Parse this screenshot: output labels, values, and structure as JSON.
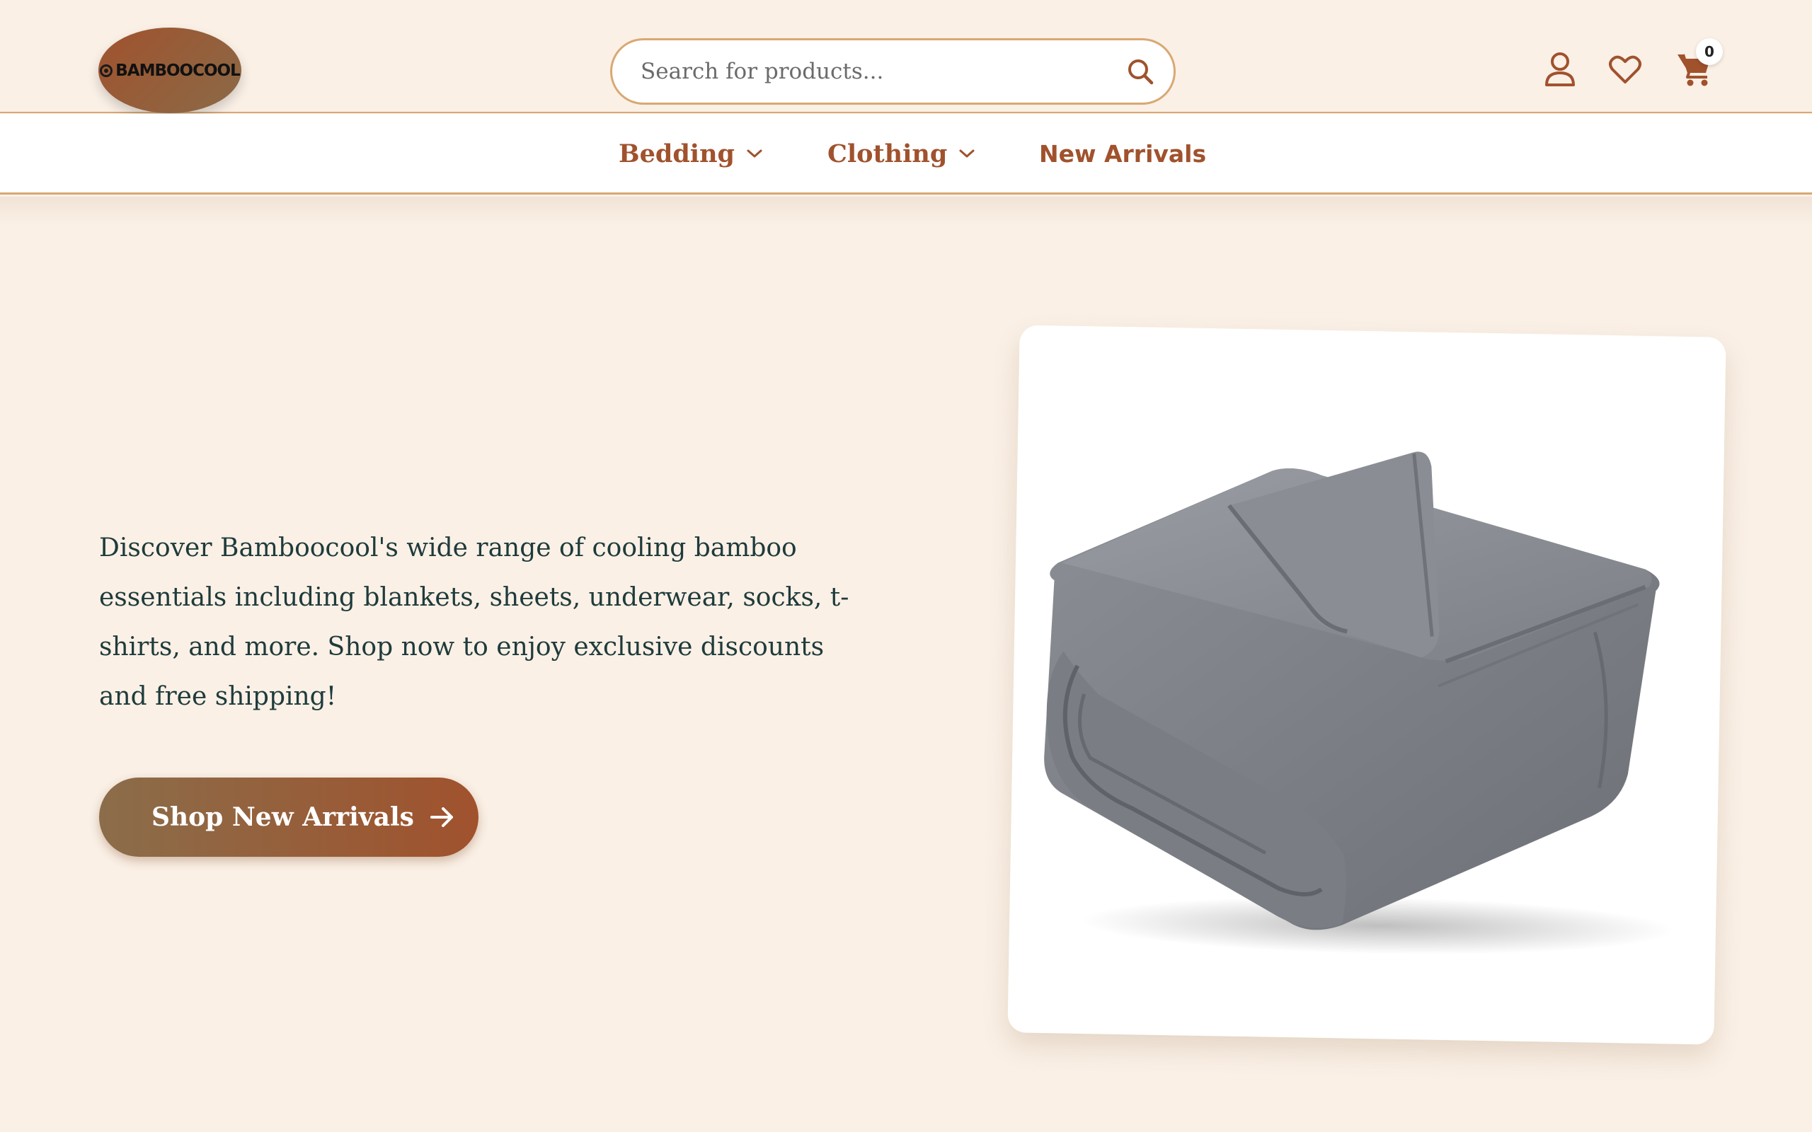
{
  "header": {
    "logo_text": "BAMBOOCOOL",
    "search": {
      "placeholder": "Search for products..."
    },
    "cart_count": "0"
  },
  "nav": {
    "items": [
      {
        "label": "Bedding",
        "has_dropdown": true
      },
      {
        "label": "Clothing",
        "has_dropdown": true
      },
      {
        "label": "New Arrivals",
        "has_dropdown": false
      }
    ]
  },
  "hero": {
    "description": "Discover Bamboocool's wide range of cooling bamboo essentials including blankets, sheets, underwear, socks, t-shirts, and more. Shop now to enjoy exclusive discounts and free shipping!",
    "cta_label": "Shop New Arrivals",
    "image": "folded-gray-blanket"
  },
  "colors": {
    "background": "#faf0e6",
    "accent": "#a0522d",
    "border": "#d9a873",
    "text": "#1f3b3b"
  },
  "icons": [
    "search-icon",
    "user-icon",
    "heart-icon",
    "cart-icon",
    "chevron-down-icon",
    "arrow-right-icon"
  ]
}
